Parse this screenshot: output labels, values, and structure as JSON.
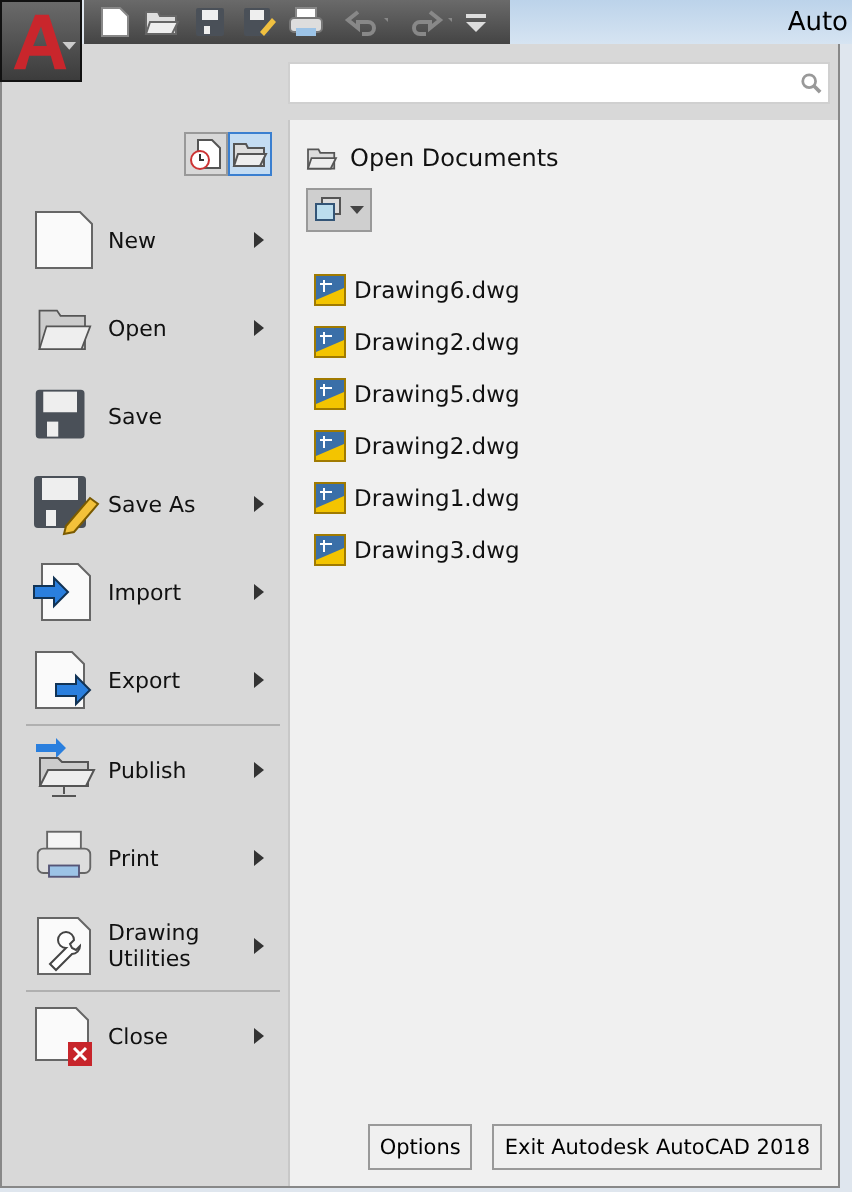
{
  "window": {
    "title": "Auto"
  },
  "view_buttons": [
    {
      "selected": false
    },
    {
      "selected": true
    }
  ],
  "section_title": "Open Documents",
  "menu": [
    {
      "label": "New",
      "submenu": true,
      "divider_before": false
    },
    {
      "label": "Open",
      "submenu": true,
      "divider_before": false
    },
    {
      "label": "Save",
      "submenu": false,
      "divider_before": false
    },
    {
      "label": "Save As",
      "submenu": true,
      "divider_before": false
    },
    {
      "label": "Import",
      "submenu": true,
      "divider_before": false
    },
    {
      "label": "Export",
      "submenu": true,
      "divider_before": false
    },
    {
      "label": "Publish",
      "submenu": true,
      "divider_before": true
    },
    {
      "label": "Print",
      "submenu": true,
      "divider_before": false
    },
    {
      "label": "Drawing Utilities",
      "submenu": true,
      "divider_before": false
    },
    {
      "label": "Close",
      "submenu": true,
      "divider_before": true
    }
  ],
  "documents": [
    "Drawing6.dwg",
    "Drawing2.dwg",
    "Drawing5.dwg",
    "Drawing2.dwg",
    "Drawing1.dwg",
    "Drawing3.dwg"
  ],
  "buttons": [
    "Options",
    "Exit Autodesk AutoCAD 2018"
  ]
}
